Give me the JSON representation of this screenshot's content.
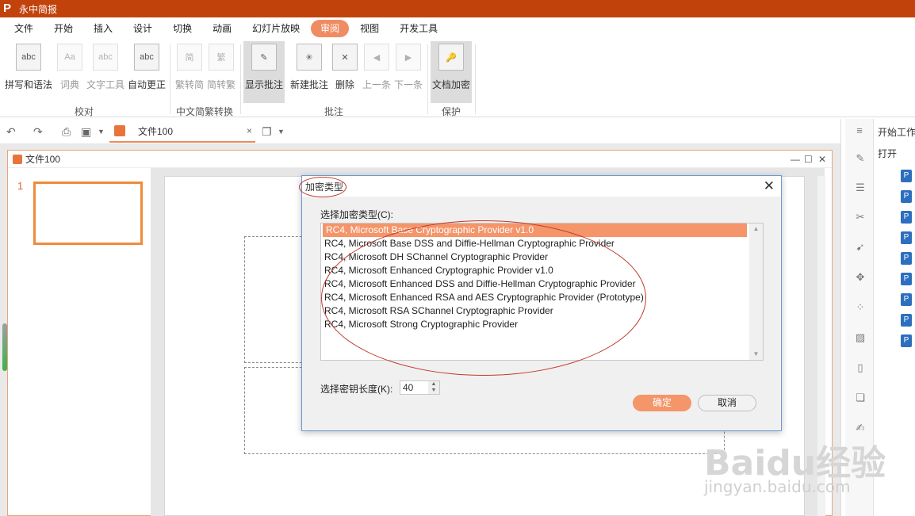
{
  "app": {
    "title": "永中简报",
    "logo": "P"
  },
  "menu": {
    "items": [
      "文件",
      "开始",
      "插入",
      "设计",
      "切换",
      "动画",
      "幻灯片放映",
      "审阅",
      "视图",
      "开发工具"
    ],
    "active": "审阅"
  },
  "ribbon": {
    "buttons": [
      "拼写和语法",
      "词典",
      "文字工具",
      "自动更正",
      "繁转简",
      "简转繁",
      "显示批注",
      "新建批注",
      "删除",
      "上一条",
      "下一条",
      "文档加密"
    ],
    "groups": [
      "校对",
      "中文简繁转换",
      "批注",
      "保护"
    ]
  },
  "tab": {
    "label": "文件100",
    "close": "×"
  },
  "docwin": {
    "title": "文件100"
  },
  "slide": {
    "number": "1"
  },
  "rightpane": {
    "title": "开始工作",
    "open": "打开"
  },
  "dialog": {
    "title": "加密类型",
    "close": "✕",
    "list_label": "选择加密类型(C):",
    "options": [
      "RC4, Microsoft Base Cryptographic Provider v1.0",
      "RC4, Microsoft Base DSS and Diffie-Hellman Cryptographic Provider",
      "RC4, Microsoft DH SChannel Cryptographic Provider",
      "RC4, Microsoft Enhanced Cryptographic Provider v1.0",
      "RC4, Microsoft Enhanced DSS and Diffie-Hellman Cryptographic Provider",
      "RC4, Microsoft Enhanced RSA and AES Cryptographic Provider (Prototype)",
      "RC4, Microsoft RSA SChannel Cryptographic Provider",
      "RC4, Microsoft Strong Cryptographic Provider"
    ],
    "key_label": "选择密钥长度(K):",
    "key_value": "40",
    "ok": "确定",
    "cancel": "取消"
  },
  "watermark": {
    "brand": "Baidu经验",
    "url": "jingyan.baidu.com"
  },
  "colors": {
    "titlebar": "#c1420b",
    "accent": "#f4956a",
    "annotation": "#c0392b"
  }
}
